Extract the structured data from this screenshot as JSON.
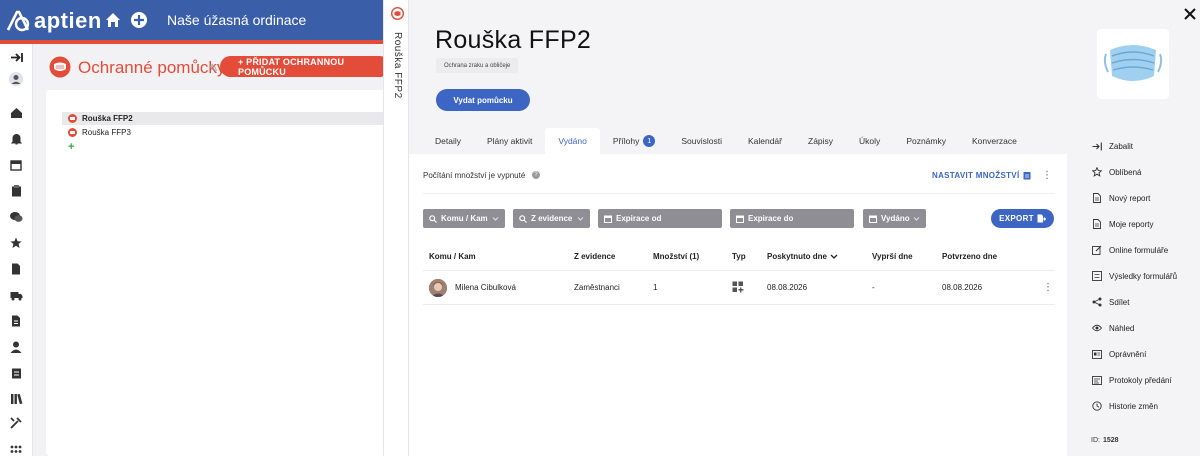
{
  "app": {
    "logo_text": "aptien",
    "practice_name": "Naše úžasná ordinace"
  },
  "background": {
    "section_title": "Ochranné pomůcky",
    "add_button": "+ PŘIDAT OCHRANNOU POMŮCKU",
    "list": [
      {
        "label": "Rouška FFP2",
        "selected": true
      },
      {
        "label": "Rouška FFP3",
        "selected": false
      }
    ]
  },
  "strip": {
    "vertical_title": "Rouška FFP2"
  },
  "detail": {
    "title": "Rouška FFP2",
    "category": "Ochrana zraku a obličeje",
    "issue_button": "Vydat pomůcku",
    "tabs": [
      {
        "label": "Detaily"
      },
      {
        "label": "Plány aktivit"
      },
      {
        "label": "Vydáno",
        "active": true
      },
      {
        "label": "Přílohy",
        "badge": "1"
      },
      {
        "label": "Souvislosti"
      },
      {
        "label": "Kalendář"
      },
      {
        "label": "Zápisy"
      },
      {
        "label": "Úkoly"
      },
      {
        "label": "Poznámky"
      },
      {
        "label": "Konverzace"
      }
    ],
    "counting_text": "Počítání množství je vypnuté",
    "help_mark": "?",
    "set_quantity": "NASTAVIT MNOŽSTVÍ",
    "filters": [
      {
        "label": "Komu / Kam",
        "icon": "search-icon"
      },
      {
        "label": "Z evidence",
        "icon": "search-icon"
      },
      {
        "label": "Expirace od",
        "icon": "calendar-icon"
      },
      {
        "label": "Expirace do",
        "icon": "calendar-icon"
      },
      {
        "label": "Vydáno",
        "icon": "calendar-icon"
      }
    ],
    "export_button": "EXPORT",
    "table": {
      "headers": [
        "Komu / Kam",
        "Z evidence",
        "Množství (1)",
        "Typ",
        "Poskytnuto dne",
        "Vyprší dne",
        "Potvrzeno dne"
      ],
      "rows": [
        {
          "name": "Milena Cibulková",
          "evidence": "Zaměstnanci",
          "quantity": "1",
          "type_icon": "grid-add-icon",
          "provided": "08.08.2026",
          "expires": "-",
          "confirmed": "08.08.2026"
        }
      ]
    },
    "actions": [
      {
        "label": "Zabalit",
        "icon": "collapse-icon"
      },
      {
        "label": "Oblíbená",
        "icon": "star-icon"
      },
      {
        "label": "Nový report",
        "icon": "report-icon"
      },
      {
        "label": "Moje reporty",
        "icon": "report-icon"
      },
      {
        "label": "Online formuláře",
        "icon": "form-edit-icon"
      },
      {
        "label": "Výsledky formulářů",
        "icon": "form-results-icon"
      },
      {
        "label": "Sdílet",
        "icon": "share-icon"
      },
      {
        "label": "Náhled",
        "icon": "eye-icon"
      },
      {
        "label": "Oprávnění",
        "icon": "permissions-icon"
      },
      {
        "label": "Protokoly předání",
        "icon": "handover-icon"
      },
      {
        "label": "Historie změn",
        "icon": "history-icon"
      }
    ],
    "record_id_label": "ID:",
    "record_id": "1528"
  },
  "colors": {
    "brand_blue": "#3a5ea8",
    "accent_red": "#e44c3a",
    "primary_button": "#3d66c4",
    "filter_grey": "#8e8e94"
  }
}
